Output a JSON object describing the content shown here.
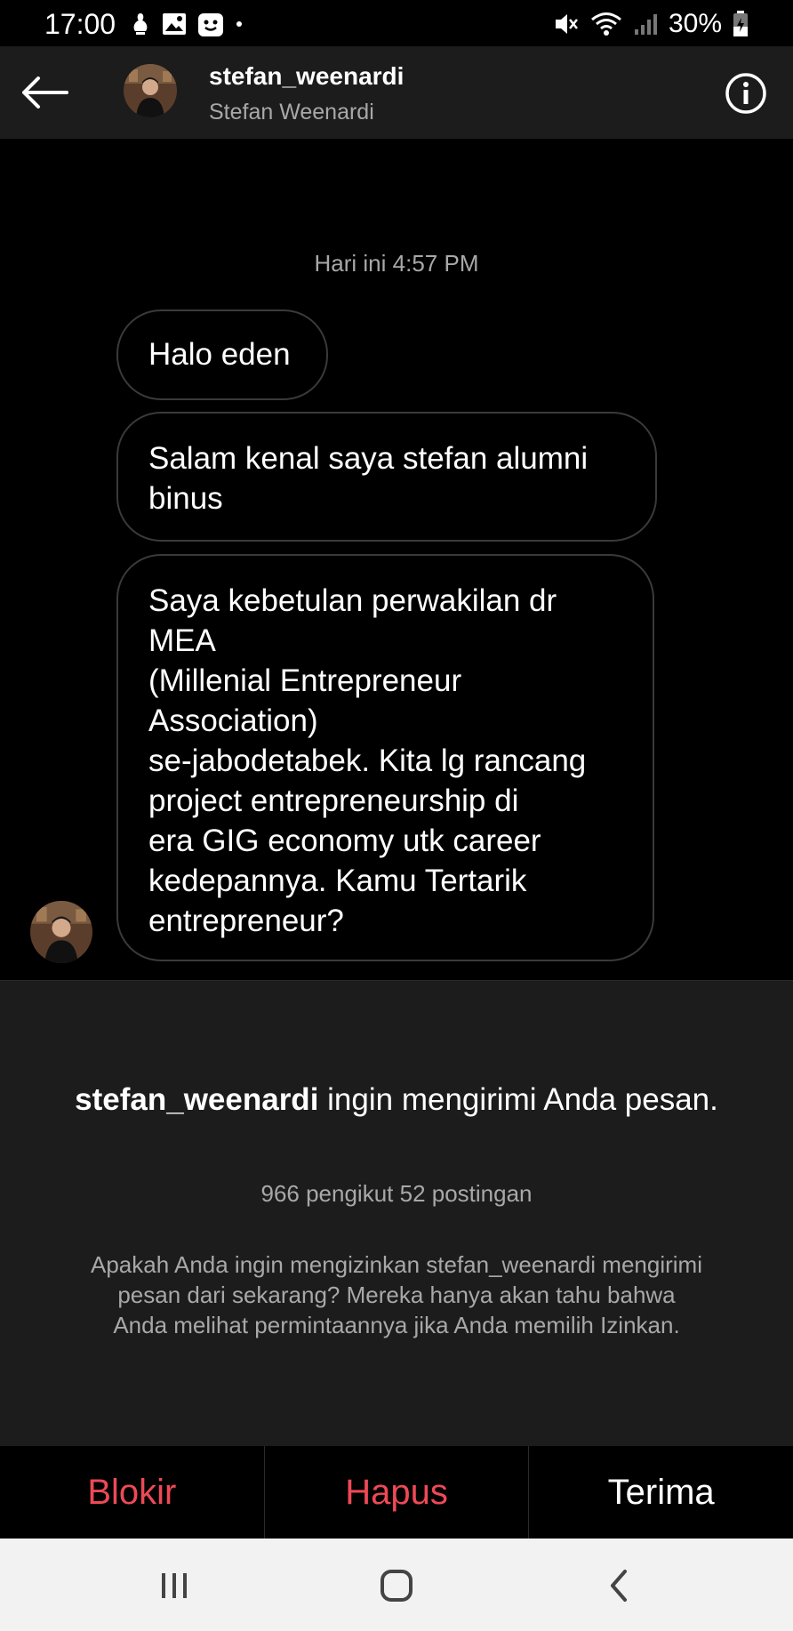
{
  "status_bar": {
    "time": "17:00",
    "battery": "30%"
  },
  "header": {
    "username": "stefan_weenardi",
    "fullname": "Stefan Weenardi"
  },
  "chat": {
    "timestamp": "Hari ini 4:57 PM",
    "messages": [
      {
        "text": "Halo eden"
      },
      {
        "text": "Salam kenal saya stefan alumni\nbinus"
      },
      {
        "text": "Saya kebetulan perwakilan dr\nMEA\n(Millenial Entrepreneur\nAssociation)\nse-jabodetabek. Kita lg rancang\nproject entrepreneurship di\nera GIG economy utk career\nkedepannya. Kamu Tertarik\nentrepreneur?"
      }
    ]
  },
  "request": {
    "title_user": "stefan_weenardi",
    "title_rest": " ingin mengirimi Anda pesan.",
    "stats": "966 pengikut 52 postingan",
    "description": "Apakah Anda ingin mengizinkan stefan_weenardi mengirimi pesan dari sekarang? Mereka hanya akan tahu bahwa Anda melihat permintaannya jika Anda memilih Izinkan."
  },
  "actions": {
    "block": "Blokir",
    "delete": "Hapus",
    "accept": "Terima"
  },
  "colors": {
    "danger": "#ed4956",
    "panel": "#1c1c1c",
    "secondary_text": "#a8a8a8"
  }
}
